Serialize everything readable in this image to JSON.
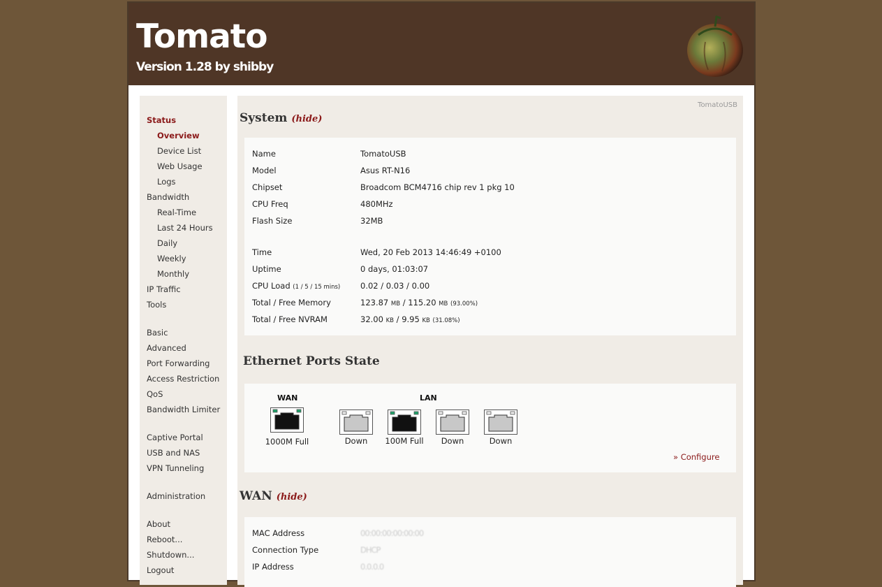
{
  "header": {
    "title": "Tomato",
    "version": "Version 1.28 by shibby"
  },
  "sidebar": {
    "items": [
      {
        "label": "Status",
        "active": true,
        "sub": false
      },
      {
        "label": "Overview",
        "active": true,
        "sub": true
      },
      {
        "label": "Device List",
        "sub": true
      },
      {
        "label": "Web Usage",
        "sub": true
      },
      {
        "label": "Logs",
        "sub": true
      },
      {
        "label": "Bandwidth",
        "sub": false
      },
      {
        "label": "Real-Time",
        "sub": true
      },
      {
        "label": "Last 24 Hours",
        "sub": true
      },
      {
        "label": "Daily",
        "sub": true
      },
      {
        "label": "Weekly",
        "sub": true
      },
      {
        "label": "Monthly",
        "sub": true
      },
      {
        "label": "IP Traffic",
        "sub": false
      },
      {
        "label": "Tools",
        "sub": false
      },
      {
        "label": "Basic",
        "sub": false
      },
      {
        "label": "Advanced",
        "sub": false
      },
      {
        "label": "Port Forwarding",
        "sub": false
      },
      {
        "label": "Access Restriction",
        "sub": false
      },
      {
        "label": "QoS",
        "sub": false
      },
      {
        "label": "Bandwidth Limiter",
        "sub": false
      },
      {
        "label": "Captive Portal",
        "sub": false
      },
      {
        "label": "USB and NAS",
        "sub": false
      },
      {
        "label": "VPN Tunneling",
        "sub": false
      },
      {
        "label": "Administration",
        "sub": false
      },
      {
        "label": "About",
        "sub": false
      },
      {
        "label": "Reboot...",
        "sub": false
      },
      {
        "label": "Shutdown...",
        "sub": false
      },
      {
        "label": "Logout",
        "sub": false
      }
    ]
  },
  "content": {
    "brand_tag": "TomatoUSB",
    "hide_label": "(hide)",
    "system": {
      "title": "System",
      "name_label": "Name",
      "name_value": "TomatoUSB",
      "model_label": "Model",
      "model_value": "Asus RT-N16",
      "chipset_label": "Chipset",
      "chipset_value": "Broadcom BCM4716 chip rev 1 pkg 10",
      "cpufreq_label": "CPU Freq",
      "cpufreq_value": "480MHz",
      "flash_label": "Flash Size",
      "flash_value": "32MB",
      "time_label": "Time",
      "time_value": "Wed, 20 Feb 2013 14:46:49 +0100",
      "uptime_label": "Uptime",
      "uptime_value": "0 days, 01:03:07",
      "cpuload_label": "CPU Load",
      "cpuload_note": "(1 / 5 / 15 mins)",
      "cpuload_1": "0.02",
      "cpuload_5": "0.03",
      "cpuload_15": "0.00",
      "memory_label": "Total / Free Memory",
      "memory_total": "123.87",
      "memory_free": "115.20",
      "memory_unit": "MB",
      "memory_pct": "(93.00%)",
      "nvram_label": "Total / Free NVRAM",
      "nvram_total": "32.00",
      "nvram_free": "9.95",
      "nvram_unit": "KB",
      "nvram_pct": "(31.08%)"
    },
    "ethernet": {
      "title": "Ethernet Ports State",
      "wan_label": "WAN",
      "lan_label": "LAN",
      "ports": [
        {
          "status": "1000M Full",
          "link": true
        },
        {
          "status": "Down",
          "link": false
        },
        {
          "status": "100M Full",
          "link": true
        },
        {
          "status": "Down",
          "link": false
        },
        {
          "status": "Down",
          "link": false
        }
      ],
      "configure": "» Configure"
    },
    "wan": {
      "title": "WAN",
      "mac_label": "MAC Address",
      "mac_value": "00:00:00:00:00:00",
      "conn_label": "Connection Type",
      "conn_value": "DHCP",
      "ip_label": "IP Address",
      "ip_value": "0.0.0.0"
    }
  },
  "colors": {
    "background": "#6e5639",
    "header": "#4f3626",
    "panel": "#f0ece6",
    "accent": "#8b1a1a"
  }
}
